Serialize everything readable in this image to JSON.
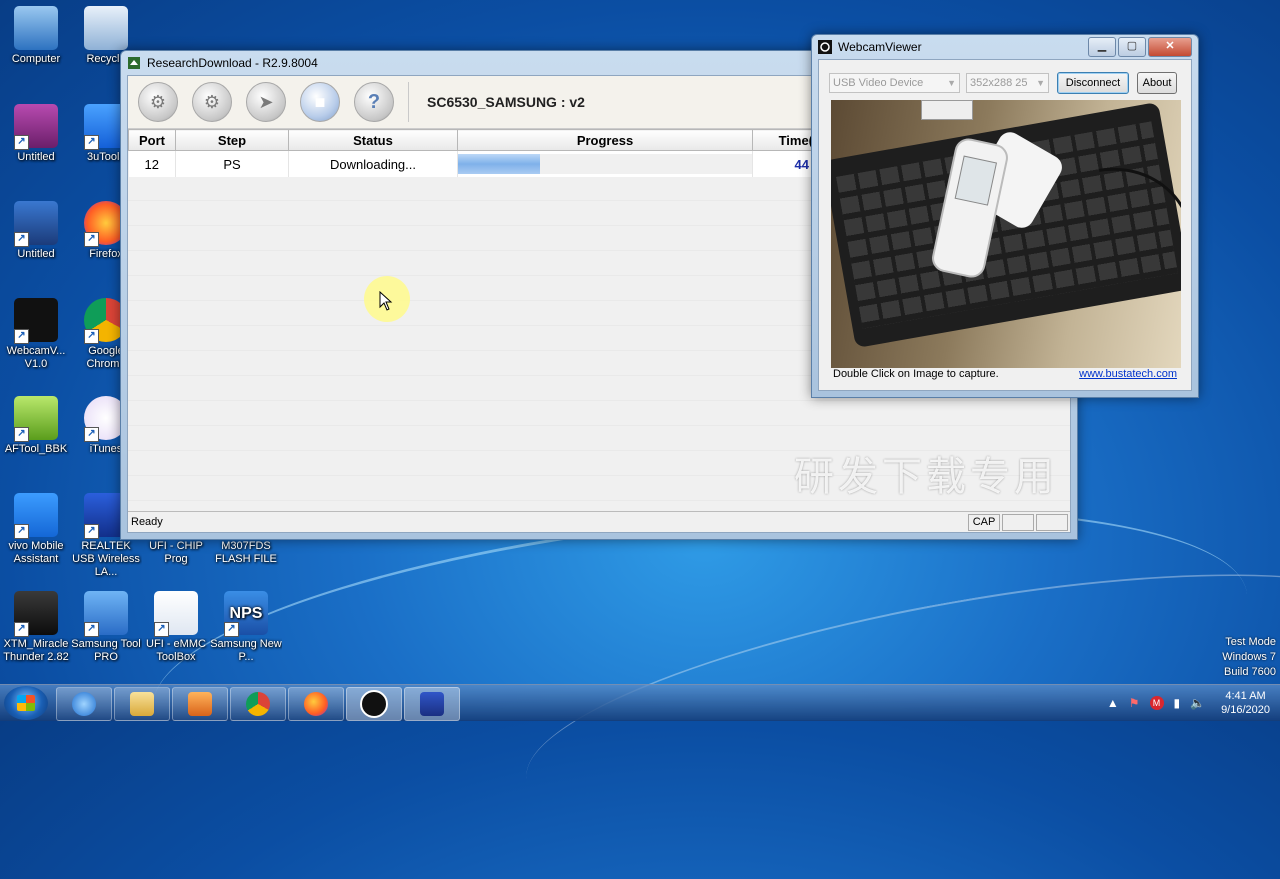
{
  "desktop": {
    "icons": [
      {
        "label": "Computer",
        "icon": "computer-icon"
      },
      {
        "label": "Recycle",
        "icon": "recycle-bin-icon"
      },
      {
        "label": "Untitled",
        "icon": "video-icon"
      },
      {
        "label": "3uTools",
        "icon": "3utools-icon"
      },
      {
        "label": "Untitled",
        "icon": "screen-icon"
      },
      {
        "label": "Firefox",
        "icon": "firefox-icon"
      },
      {
        "label": "WebcamV... V1.0",
        "icon": "webcam-icon"
      },
      {
        "label": "Google Chrome",
        "icon": "chrome-icon"
      },
      {
        "label": "AFTool_BBK",
        "icon": "android-icon"
      },
      {
        "label": "iTunes",
        "icon": "itunes-icon"
      },
      {
        "label": "vivo Mobile Assistant",
        "icon": "vivo-icon"
      },
      {
        "label": "REALTEK USB Wireless LA...",
        "icon": "realtek-icon"
      },
      {
        "label": "UFI - CHIP Prog",
        "icon": "ufi-chip-icon"
      },
      {
        "label": "M307FDS FLASH FILE",
        "icon": "folder-icon"
      },
      {
        "label": "XTM_Miracle Thunder 2.82",
        "icon": "miracle-icon"
      },
      {
        "label": "Samsung Tool PRO",
        "icon": "samsung-tool-icon"
      },
      {
        "label": "UFI - eMMC ToolBox",
        "icon": "ufi-emmc-icon"
      },
      {
        "label": "Samsung New P...",
        "icon": "nps-icon"
      }
    ],
    "test_mode": {
      "line1": "Test Mode",
      "line2": "Windows 7",
      "line3": "Build 7600"
    }
  },
  "research_download": {
    "title": "ResearchDownload - R2.9.8004",
    "project": "SC6530_SAMSUNG : v2",
    "columns": [
      "Port",
      "Step",
      "Status",
      "Progress",
      "Time("
    ],
    "row": {
      "port": "12",
      "step": "PS",
      "status": "Downloading...",
      "progress": 0.28,
      "time": "44"
    },
    "watermark": "研发下载专用",
    "status_ready": "Ready",
    "status_cap": "CAP"
  },
  "webcam_viewer": {
    "title": "WebcamViewer",
    "device": "USB Video Device",
    "resolution": "352x288 25",
    "disconnect_label": "Disconnect",
    "about_label": "About",
    "hint": "Double Click on Image to capture.",
    "link": "www.bustatech.com"
  },
  "taskbar": {
    "time": "4:41 AM",
    "date": "9/16/2020"
  }
}
